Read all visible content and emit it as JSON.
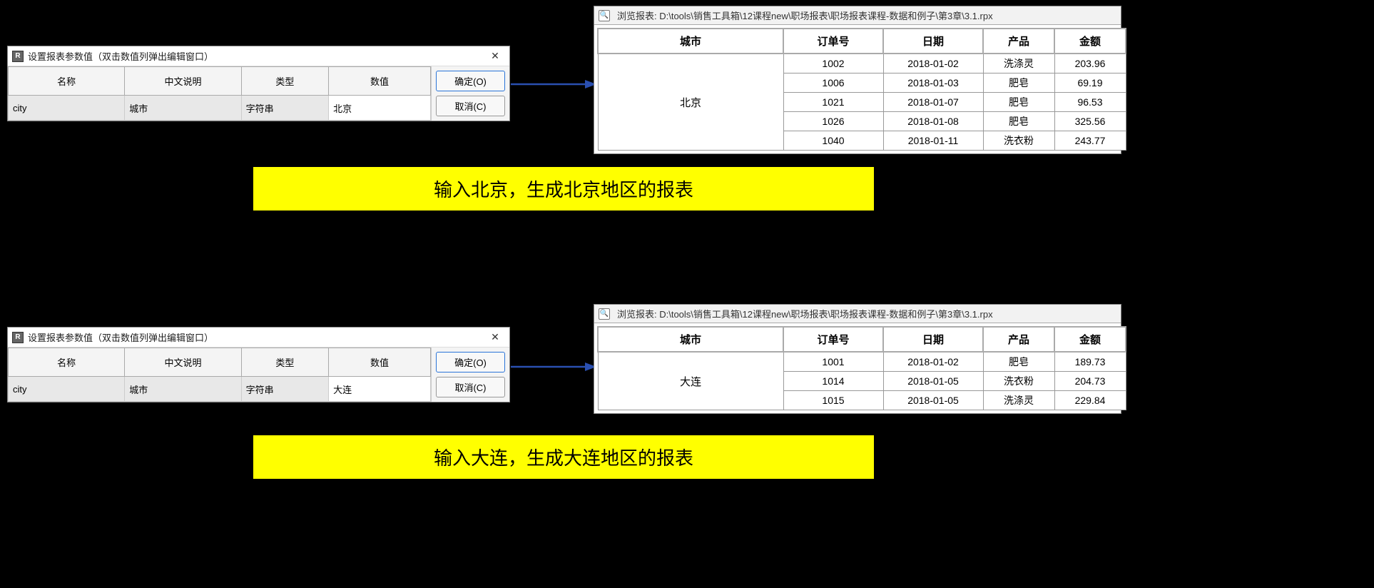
{
  "dialog1": {
    "title": "设置报表参数值（双击数值列弹出编辑窗口）",
    "headers": [
      "名称",
      "中文说明",
      "类型",
      "数值"
    ],
    "row": {
      "name": "city",
      "desc": "城市",
      "type": "字符串",
      "value": "北京"
    },
    "okLabel": "确定(O)",
    "cancelLabel": "取消(C)"
  },
  "dialog2": {
    "title": "设置报表参数值（双击数值列弹出编辑窗口）",
    "headers": [
      "名称",
      "中文说明",
      "类型",
      "数值"
    ],
    "row": {
      "name": "city",
      "desc": "城市",
      "type": "字符串",
      "value": "大连"
    },
    "okLabel": "确定(O)",
    "cancelLabel": "取消(C)"
  },
  "report1": {
    "titlebar": "浏览报表: D:\\tools\\销售工具箱\\12课程new\\职场报表\\职场报表课程-数据和例子\\第3章\\3.1.rpx",
    "headers": [
      "城市",
      "订单号",
      "日期",
      "产品",
      "金额"
    ],
    "city": "北京",
    "rows": [
      {
        "order": "1002",
        "date": "2018-01-02",
        "product": "洗涤灵",
        "amount": "203.96"
      },
      {
        "order": "1006",
        "date": "2018-01-03",
        "product": "肥皂",
        "amount": "69.19"
      },
      {
        "order": "1021",
        "date": "2018-01-07",
        "product": "肥皂",
        "amount": "96.53"
      },
      {
        "order": "1026",
        "date": "2018-01-08",
        "product": "肥皂",
        "amount": "325.56"
      },
      {
        "order": "1040",
        "date": "2018-01-11",
        "product": "洗衣粉",
        "amount": "243.77"
      }
    ]
  },
  "report2": {
    "titlebar": "浏览报表: D:\\tools\\销售工具箱\\12课程new\\职场报表\\职场报表课程-数据和例子\\第3章\\3.1.rpx",
    "headers": [
      "城市",
      "订单号",
      "日期",
      "产品",
      "金额"
    ],
    "city": "大连",
    "rows": [
      {
        "order": "1001",
        "date": "2018-01-02",
        "product": "肥皂",
        "amount": "189.73"
      },
      {
        "order": "1014",
        "date": "2018-01-05",
        "product": "洗衣粉",
        "amount": "204.73"
      },
      {
        "order": "1015",
        "date": "2018-01-05",
        "product": "洗涤灵",
        "amount": "229.84"
      }
    ]
  },
  "caption1": "输入北京，生成北京地区的报表",
  "caption2": "输入大连，生成大连地区的报表"
}
